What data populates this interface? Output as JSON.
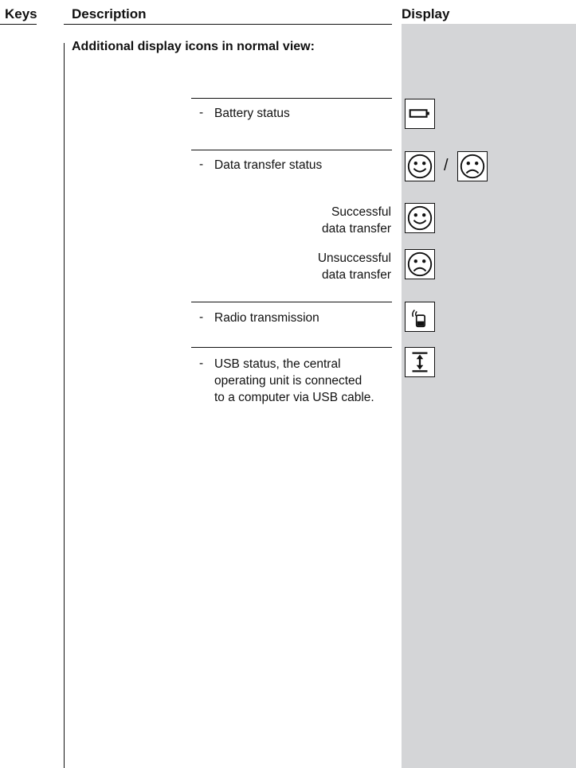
{
  "header": {
    "keys_label": "Keys",
    "description_label": "Description",
    "display_label": "Display"
  },
  "section": {
    "title": "Additional display icons in normal view:"
  },
  "items": [
    {
      "dash": "-",
      "text": "Battery status",
      "icon": "battery-icon"
    },
    {
      "dash": "-",
      "text": "Data transfer status",
      "icon": "happy-face-icon / sad-face-icon",
      "separator": "/"
    },
    {
      "text_line1": "Successful",
      "text_line2": "data transfer",
      "icon": "happy-face-icon"
    },
    {
      "text_line1": "Unsuccessful",
      "text_line2": "data transfer",
      "icon": "sad-face-icon"
    },
    {
      "dash": "-",
      "text": "Radio transmission",
      "icon": "radio-signal-icon"
    },
    {
      "dash": "-",
      "text_line1": "USB status, the central",
      "text_line2": "operating unit is connected",
      "text_line3": "to a computer via USB cable.",
      "icon": "usb-arrow-icon"
    }
  ],
  "colors": {
    "display_column": "#d4d5d7",
    "text": "#111111"
  }
}
